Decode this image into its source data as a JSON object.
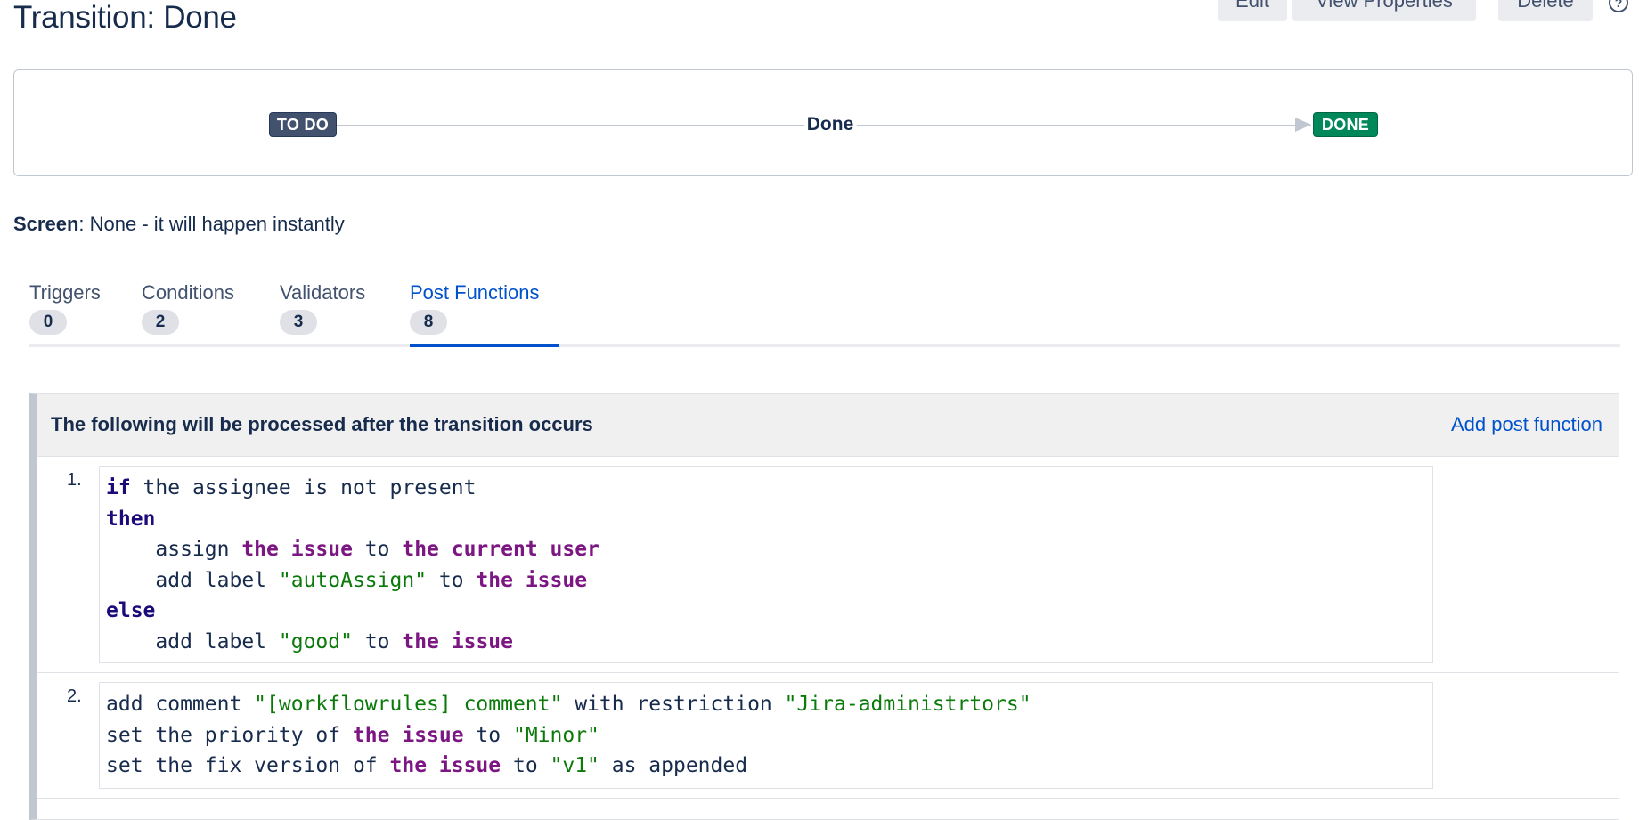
{
  "header": {
    "title": "Transition: Done",
    "buttons": {
      "edit": "Edit",
      "view_properties": "View Properties",
      "delete": "Delete"
    },
    "help_icon": "?"
  },
  "diagram": {
    "from_status": "TO DO",
    "to_status": "DONE",
    "transition_label": "Done",
    "colors": {
      "todo": "#42526e",
      "done": "#00875a"
    }
  },
  "screen": {
    "label": "Screen",
    "value": ": None - it will happen instantly"
  },
  "tabs": [
    {
      "label": "Triggers",
      "count": "0"
    },
    {
      "label": "Conditions",
      "count": "2"
    },
    {
      "label": "Validators",
      "count": "3"
    },
    {
      "label": "Post Functions",
      "count": "8"
    }
  ],
  "active_tab": "Post Functions",
  "panel": {
    "title": "The following will be processed after the transition occurs",
    "add_link": "Add post function"
  },
  "rules": [
    {
      "number": "1.",
      "lines": [
        [
          {
            "t": "if",
            "c": "kw"
          },
          {
            "t": " the assignee is not present",
            "c": ""
          }
        ],
        [
          {
            "t": "then",
            "c": "kw"
          }
        ],
        [
          {
            "t": "    assign ",
            "c": ""
          },
          {
            "t": "the issue",
            "c": "obj"
          },
          {
            "t": " to ",
            "c": ""
          },
          {
            "t": "the current user",
            "c": "obj"
          }
        ],
        [
          {
            "t": "    add label ",
            "c": ""
          },
          {
            "t": "\"autoAssign\"",
            "c": "str"
          },
          {
            "t": " to ",
            "c": ""
          },
          {
            "t": "the issue",
            "c": "obj"
          }
        ],
        [
          {
            "t": "else",
            "c": "kw"
          }
        ],
        [
          {
            "t": "    add label ",
            "c": ""
          },
          {
            "t": "\"good\"",
            "c": "str"
          },
          {
            "t": " to ",
            "c": ""
          },
          {
            "t": "the issue",
            "c": "obj"
          }
        ]
      ]
    },
    {
      "number": "2.",
      "lines": [
        [
          {
            "t": "add comment ",
            "c": ""
          },
          {
            "t": "\"[workflowrules] comment\"",
            "c": "str"
          },
          {
            "t": " with restriction ",
            "c": ""
          },
          {
            "t": "\"Jira-administrtors\"",
            "c": "str"
          }
        ],
        [
          {
            "t": "set the priority of ",
            "c": ""
          },
          {
            "t": "the issue",
            "c": "obj"
          },
          {
            "t": " to ",
            "c": ""
          },
          {
            "t": "\"Minor\"",
            "c": "str"
          }
        ],
        [
          {
            "t": "set the fix version of ",
            "c": ""
          },
          {
            "t": "the issue",
            "c": "obj"
          },
          {
            "t": " to ",
            "c": ""
          },
          {
            "t": "\"v1\"",
            "c": "str"
          },
          {
            "t": " as appended",
            "c": ""
          }
        ]
      ]
    }
  ]
}
